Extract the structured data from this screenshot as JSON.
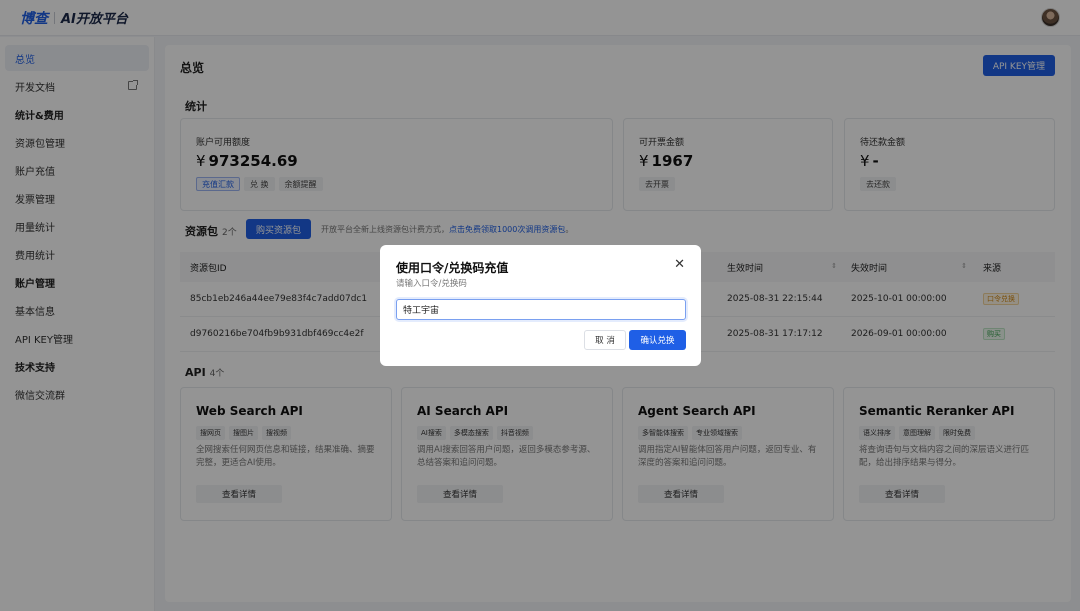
{
  "topbar": {
    "logo_text": "博查",
    "title": "AI开放平台"
  },
  "sidebar": {
    "items": [
      {
        "label": "总览"
      },
      {
        "label": "开发文档"
      },
      {
        "label": "统计&费用"
      },
      {
        "label": "资源包管理"
      },
      {
        "label": "账户充值"
      },
      {
        "label": "发票管理"
      },
      {
        "label": "用量统计"
      },
      {
        "label": "费用统计"
      },
      {
        "label": "账户管理"
      },
      {
        "label": "基本信息"
      },
      {
        "label": "API KEY管理"
      },
      {
        "label": "技术支持"
      },
      {
        "label": "微信交流群"
      }
    ]
  },
  "main": {
    "title": "总览",
    "apikey_button": "API KEY管理",
    "stats_heading": "统计",
    "balance": {
      "label": "账户可用额度",
      "currency": "¥",
      "value": "973254.69",
      "tags": [
        "充值汇款",
        "兑 换",
        "余额提醒"
      ]
    },
    "invoice": {
      "label": "可开票金额",
      "currency": "¥",
      "value": "1967",
      "tag": "去开票"
    },
    "due": {
      "label": "待还款金额",
      "currency": "¥",
      "value": "-",
      "tag": "去还款"
    },
    "packages": {
      "heading": "资源包",
      "count": "2个",
      "buy_button": "购买资源包",
      "promo_text": "开放平台全新上线资源包计费方式，",
      "promo_link": "点击免费领取1000次调用资源包",
      "promo_end": "。",
      "columns": [
        "资源包ID",
        "生效时间",
        "失效时间",
        "来源"
      ],
      "rows": [
        {
          "id": "85cb1eb246a44ee79e83f4c7add07dc1",
          "partial": "0",
          "start": "2025-08-31 22:15:44",
          "end": "2025-10-01 00:00:00",
          "source": "口令兑换"
        },
        {
          "id": "d9760216be704fb9b931dbf469cc4e2f",
          "partial": "1",
          "start": "2025-08-31 17:17:12",
          "end": "2026-09-01 00:00:00",
          "source": "购买"
        }
      ]
    },
    "api": {
      "heading": "API",
      "count": "4个",
      "detail_label": "查看详情",
      "cards": [
        {
          "title": "Web Search API",
          "tags": [
            "搜网页",
            "搜图片",
            "搜视频"
          ],
          "desc": "全网搜索任何网页信息和链接，结果准确、摘要完整，更适合AI使用。"
        },
        {
          "title": "AI Search API",
          "tags": [
            "AI搜索",
            "多模态搜索",
            "抖音视频"
          ],
          "desc": "调用AI搜索回答用户问题，返回多模态参考源、总结答案和追问问题。"
        },
        {
          "title": "Agent Search API",
          "tags": [
            "多智能体搜索",
            "专业领域搜索"
          ],
          "desc": "调用指定AI智能体回答用户问题，返回专业、有深度的答案和追问问题。"
        },
        {
          "title": "Semantic Reranker API",
          "tags": [
            "语义排序",
            "意图理解",
            "限时免费"
          ],
          "desc": "将查询语句与文档内容之间的深层语义进行匹配，给出排序结果与得分。"
        }
      ]
    }
  },
  "dialog": {
    "title": "使用口令/兑换码充值",
    "subtitle": "请输入口令/兑换码",
    "input_value": "特工宇宙",
    "cancel": "取 消",
    "confirm": "确认兑换"
  }
}
